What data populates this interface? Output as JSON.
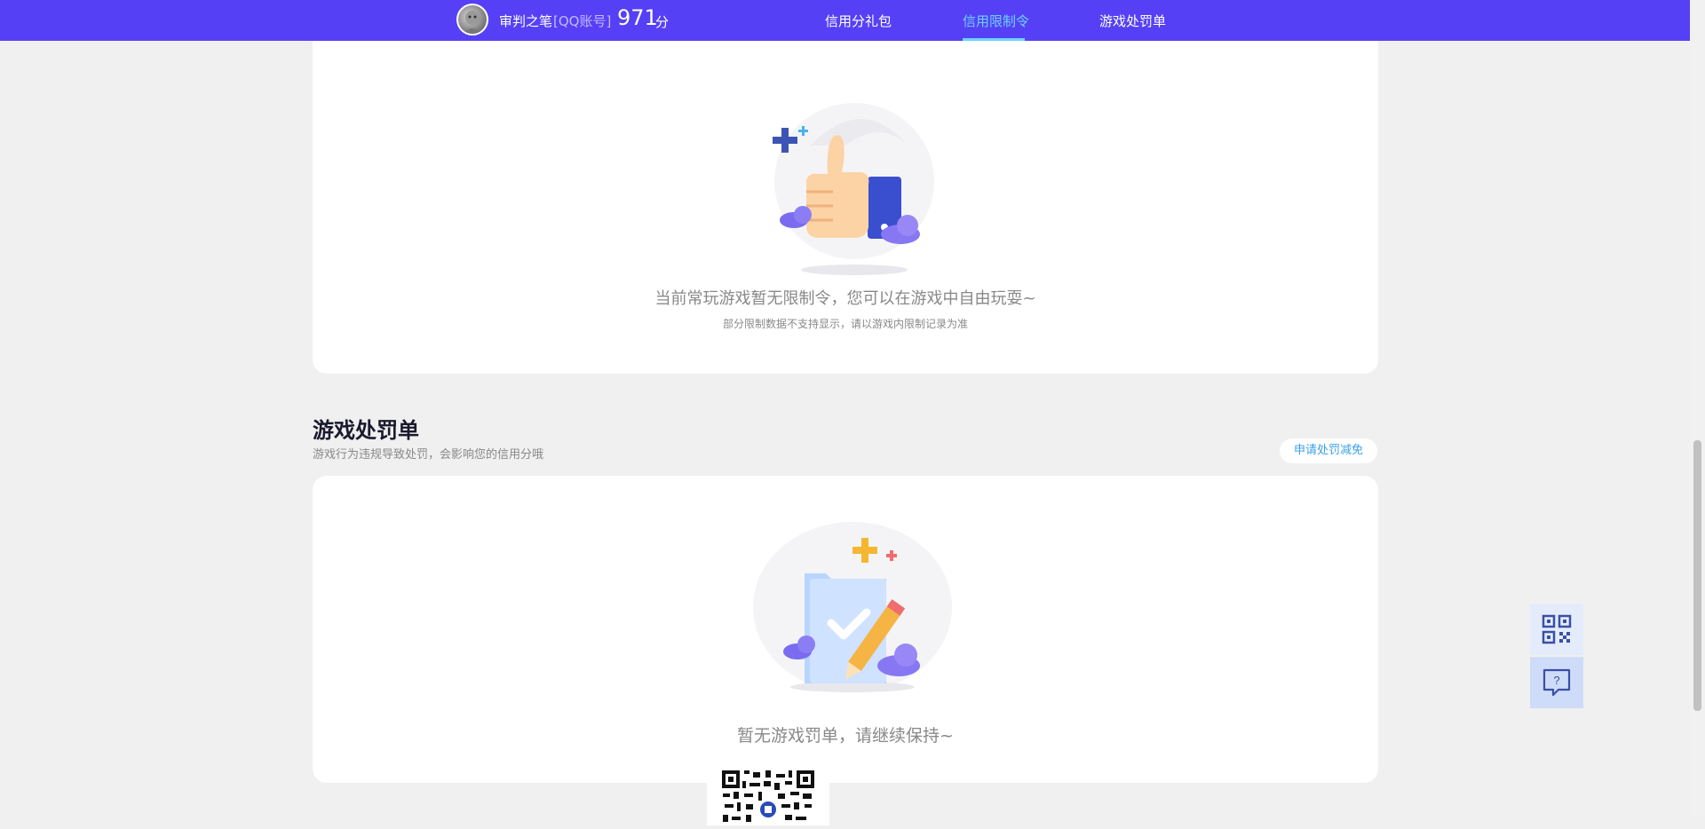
{
  "header": {
    "user_name": "审判之笔",
    "account_type": "[QQ账号]",
    "score": "971",
    "score_unit": "分",
    "nav": [
      {
        "label": "信用分礼包"
      },
      {
        "label": "信用限制令"
      },
      {
        "label": "游戏处罚单"
      }
    ],
    "active_nav": "信用限制令"
  },
  "restriction": {
    "empty_message": "当前常玩游戏暂无限制令，您可以在游戏中自由玩耍~",
    "note": "部分限制数据不支持显示，请以游戏内限制记录为准"
  },
  "penalty": {
    "title": "游戏处罚单",
    "subtitle": "游戏行为违规导致处罚，会影响您的信用分哦",
    "appeal_button": "申请处罚减免",
    "empty_message": "暂无游戏罚单，请继续保持~"
  },
  "colors": {
    "brand": "#5640f5",
    "active_nav": "#6cd3ff",
    "link": "#3aa0e8"
  },
  "icons": {
    "qr": "qr-code-icon",
    "help": "help-chat-icon"
  }
}
